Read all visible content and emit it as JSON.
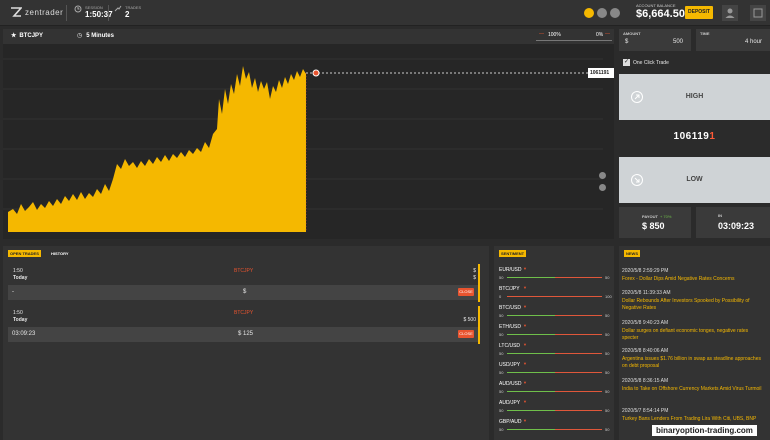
{
  "header": {
    "logo_text": "zentrader",
    "session_label": "SESSION",
    "session_value": "1:50:37",
    "trades_label": "TRADES",
    "trades_value": "2",
    "balance_label": "ACCOUNT BALANCE",
    "balance_value": "$6,664.50",
    "deposit_label": "DEPOSIT"
  },
  "chart_toolbar": {
    "asset": "BTCJPY",
    "timeframe": "5 Minutes",
    "pct_left": "100%",
    "pct_right": "0%"
  },
  "chart": {
    "current_price": "1061191"
  },
  "trade_panel": {
    "amount_label": "AMOUNT",
    "amount_currency": "$",
    "amount_value": "500",
    "time_label": "TIME",
    "time_value": "4 hour",
    "one_click_label": "One Click Trade",
    "high_label": "HIGH",
    "strike_main": "106119",
    "strike_last": "1",
    "low_label": "LOW",
    "payout_label": "PAYOUT",
    "payout_pct": "+ 70%",
    "payout_value": "$ 850",
    "in_label": "IN",
    "in_value": "03:09:23"
  },
  "open_trades": {
    "tab_open": "OPEN TRADES",
    "tab_history": "HISTORY",
    "trades": [
      {
        "time": "1:50",
        "day": "Today",
        "asset": "BTCJPY",
        "amount_top": "$",
        "amount_top2": "$",
        "row_left": "-",
        "row_mid": "$",
        "close": "CLOSE"
      },
      {
        "time": "1:50",
        "day": "Today",
        "asset": "BTCJPY",
        "amount_top": "$ 500",
        "row_left": "03:09:23",
        "row_mid": "$ 125",
        "close": "CLOSE"
      }
    ]
  },
  "sentiment": {
    "title": "SENTIMENT",
    "items": [
      {
        "pair": "EUR/USD",
        "left": "50",
        "right": "50",
        "green": 0.5
      },
      {
        "pair": "BTC/JPY",
        "left": "0",
        "right": "100",
        "green": 0.0
      },
      {
        "pair": "BTC/USD",
        "left": "50",
        "right": "50",
        "green": 0.5
      },
      {
        "pair": "ETH/USD",
        "left": "50",
        "right": "50",
        "green": 0.5
      },
      {
        "pair": "LTC/USD",
        "left": "50",
        "right": "50",
        "green": 0.5
      },
      {
        "pair": "USD/JPY",
        "left": "50",
        "right": "50",
        "green": 0.5
      },
      {
        "pair": "AUD/USD",
        "left": "50",
        "right": "50",
        "green": 0.5
      },
      {
        "pair": "AUD/JPY",
        "left": "50",
        "right": "50",
        "green": 0.5
      },
      {
        "pair": "GBP/AUD",
        "left": "50",
        "right": "50",
        "green": 0.5
      }
    ]
  },
  "news": {
    "title": "NEWS",
    "items": [
      {
        "ts": "2020/5/8 2:59:29 PM",
        "title": "Forex - Dollar Dips Amid Negative Rates Concerns"
      },
      {
        "ts": "2020/5/8 11:39:33 AM",
        "title": "Dollar Rebounds After Investors Spooked by Possibility of Negative Rates"
      },
      {
        "ts": "2020/5/8 9:40:23 AM",
        "title": "Dollar surges on defiant economic tonges, negative rates specter"
      },
      {
        "ts": "2020/5/8 8:40:06 AM",
        "title": "Argentina issues $1.76 billion in swap as steadline approaches on debt proposal"
      },
      {
        "ts": "2020/5/8 8:36:15 AM",
        "title": "India to Take on Offshore Currency Markets Amid Virus Turmoil"
      },
      {
        "ts": "2020/5/7 8:54:14 PM",
        "title": "Turkey Bans Lenders From Trading Lira With Citi, UBS, BNP"
      }
    ]
  },
  "watermark": "binaryoption-trading.com",
  "colors": {
    "accent": "#f5b800",
    "close": "#e8542f",
    "up": "#6fbf4a",
    "down": "#e0573a"
  }
}
